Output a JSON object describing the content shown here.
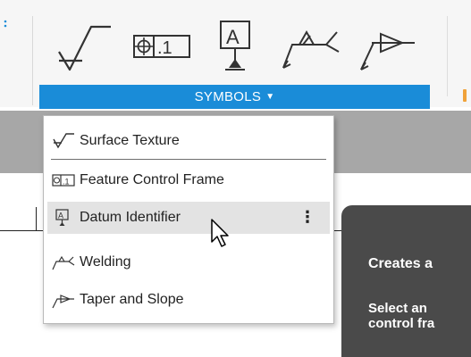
{
  "toolbar": {
    "panel_label": "SYMBOLS",
    "caret": "▼",
    "tools": [
      {
        "icon": "surface-texture-icon"
      },
      {
        "icon": "feature-control-frame-icon"
      },
      {
        "icon": "datum-identifier-icon"
      },
      {
        "icon": "welding-icon"
      },
      {
        "icon": "taper-slope-icon"
      }
    ]
  },
  "menu": {
    "items": [
      {
        "label": "Surface Texture",
        "icon": "surface-texture-icon"
      },
      {
        "label": "Feature Control Frame",
        "icon": "feature-control-frame-icon"
      },
      {
        "label": "Datum Identifier",
        "icon": "datum-identifier-icon",
        "highlighted": true,
        "more": "⋮"
      },
      {
        "label": "Welding",
        "icon": "welding-icon"
      },
      {
        "label": "Taper and Slope",
        "icon": "taper-slope-icon"
      }
    ]
  },
  "tooltip": {
    "title": "Creates a",
    "body": "Select an\ncontrol fra"
  },
  "colors": {
    "accent": "#1a8cd8",
    "highlight": "#e3e3e3",
    "tooltip_bg": "#4a4a4a"
  }
}
